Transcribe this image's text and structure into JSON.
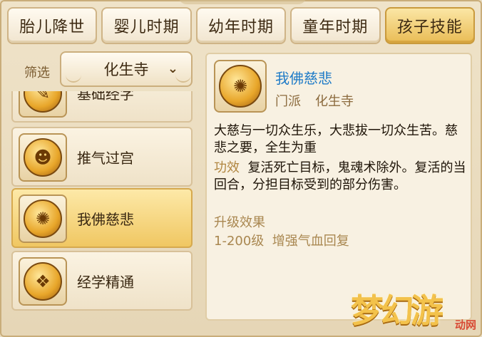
{
  "tabs": [
    {
      "label": "胎儿降世",
      "active": false
    },
    {
      "label": "婴儿时期",
      "active": false
    },
    {
      "label": "幼年时期",
      "active": false
    },
    {
      "label": "童年时期",
      "active": false
    },
    {
      "label": "孩子技能",
      "active": true
    }
  ],
  "filter": {
    "label": "筛选",
    "selected": "化生寺"
  },
  "skills": [
    {
      "label": "基础经字",
      "icon": "scroll-gold-icon"
    },
    {
      "label": "推气过宫",
      "icon": "twin-figures-gold-icon"
    },
    {
      "label": "我佛慈悲",
      "icon": "swirl-gold-icon",
      "active": true
    },
    {
      "label": "经学精通",
      "icon": "scroll-bundle-gold-icon"
    }
  ],
  "detail": {
    "name": "我佛慈悲",
    "school_label": "门派",
    "school_value": "化生寺",
    "description": "大慈与一切众生乐，大悲拔一切众生苦。慈悲之要，全生为重",
    "effect_label": "功效",
    "effect_text": "复活死亡目标，鬼魂术除外。复活的当回合，分担目标受到的部分伤害。",
    "upgrade_title": "升级效果",
    "upgrade_level": "1-200级",
    "upgrade_text": "增强气血回复"
  },
  "watermark": {
    "main": "梦幻游",
    "sub": "动网"
  },
  "colors": {
    "accent": "#1f7bc7",
    "active_tab": "#e9bc55",
    "active_item": "#f0c762"
  }
}
